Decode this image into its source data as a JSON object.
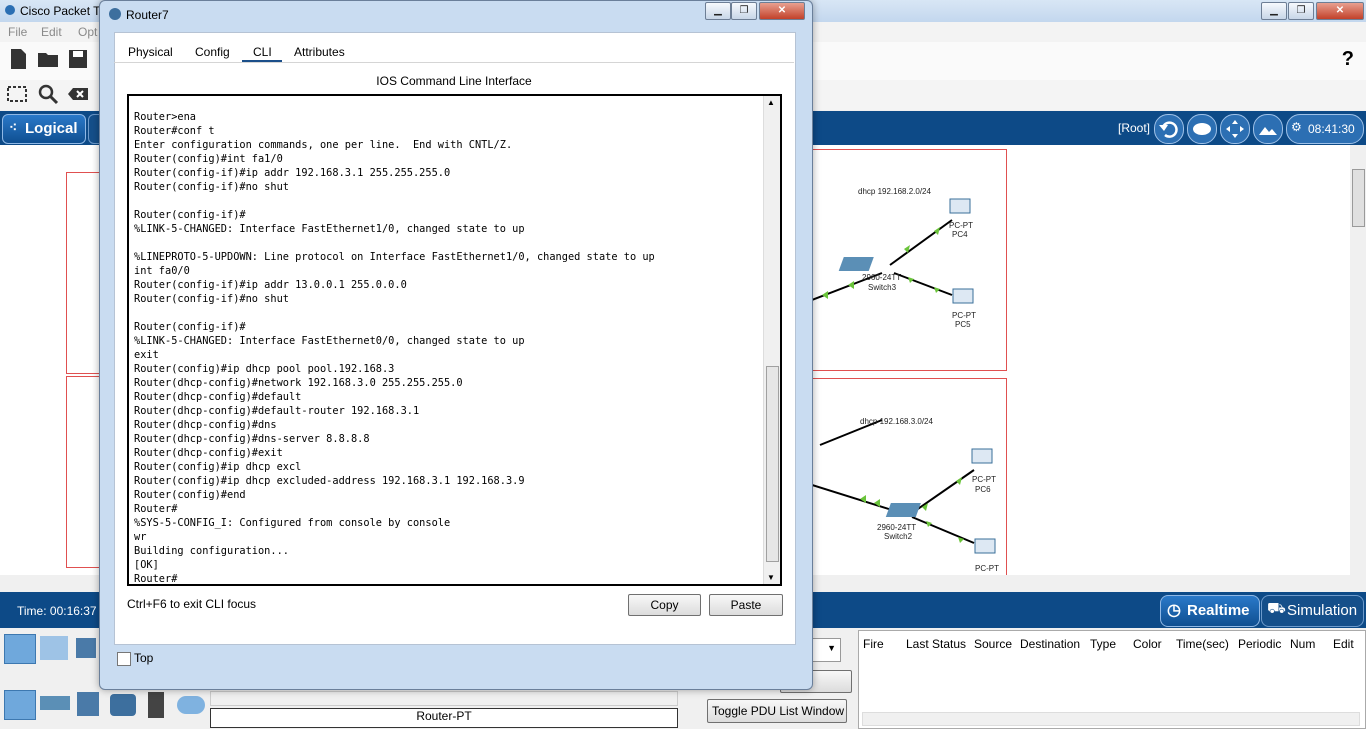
{
  "app": {
    "title": "Cisco Packet T",
    "menu": [
      "File",
      "Edit",
      "Opt"
    ]
  },
  "header": {
    "help_label": "?",
    "root_label": "[Root]",
    "clock": "08:41:30",
    "logical_label": "Logical"
  },
  "workspace": {
    "cluster_top": {
      "label": "dhcp 192.168.2.0/24",
      "pcs": [
        {
          "type": "PC-PT",
          "name": "PC4"
        },
        {
          "type": "PC-PT",
          "name": "PC5"
        }
      ],
      "switch": {
        "model": "2960-24TT",
        "name": "Switch3"
      }
    },
    "cluster_bottom": {
      "label": "dhcp 192.168.3.0/24",
      "pcs": [
        {
          "type": "PC-PT",
          "name": "PC6"
        },
        {
          "type": "PC-PT",
          "name": ""
        }
      ],
      "switch": {
        "model": "2960-24TT",
        "name": "Switch2"
      }
    }
  },
  "bottom": {
    "time": "Time: 00:16:37",
    "realtime": "Realtime",
    "simulation": "Simulation",
    "device_label": "Router-PT",
    "toggle_pdu": "Toggle PDU List Window",
    "delete_partial": "ete",
    "pdu_columns": [
      "Fire",
      "Last Status",
      "Source",
      "Destination",
      "Type",
      "Color",
      "Time(sec)",
      "Periodic",
      "Num",
      "Edit"
    ]
  },
  "dialog": {
    "title": "Router7",
    "tabs": [
      "Physical",
      "Config",
      "CLI",
      "Attributes"
    ],
    "active_tab": "CLI",
    "heading": "IOS Command Line Interface",
    "terminal_lines": [
      "Router>ena",
      "Router#conf t",
      "Enter configuration commands, one per line.  End with CNTL/Z.",
      "Router(config)#int fa1/0",
      "Router(config-if)#ip addr 192.168.3.1 255.255.255.0",
      "Router(config-if)#no shut",
      "",
      "Router(config-if)#",
      "%LINK-5-CHANGED: Interface FastEthernet1/0, changed state to up",
      "",
      "%LINEPROTO-5-UPDOWN: Line protocol on Interface FastEthernet1/0, changed state to up",
      "int fa0/0",
      "Router(config-if)#ip addr 13.0.0.1 255.0.0.0",
      "Router(config-if)#no shut",
      "",
      "Router(config-if)#",
      "%LINK-5-CHANGED: Interface FastEthernet0/0, changed state to up",
      "exit",
      "Router(config)#ip dhcp pool pool.192.168.3",
      "Router(dhcp-config)#network 192.168.3.0 255.255.255.0",
      "Router(dhcp-config)#default",
      "Router(dhcp-config)#default-router 192.168.3.1",
      "Router(dhcp-config)#dns",
      "Router(dhcp-config)#dns-server 8.8.8.8",
      "Router(dhcp-config)#exit",
      "Router(config)#ip dhcp excl",
      "Router(config)#ip dhcp excluded-address 192.168.3.1 192.168.3.9",
      "Router(config)#end",
      "Router#",
      "%SYS-5-CONFIG_I: Configured from console by console",
      "wr",
      "Building configuration...",
      "[OK]",
      "Router#"
    ],
    "exit_hint": "Ctrl+F6 to exit CLI focus",
    "copy_label": "Copy",
    "paste_label": "Paste",
    "top_label": "Top"
  },
  "colors": {
    "accent_blue": "#0d4a87",
    "cluster_border": "#e05050",
    "link_green": "#6ac43a"
  }
}
